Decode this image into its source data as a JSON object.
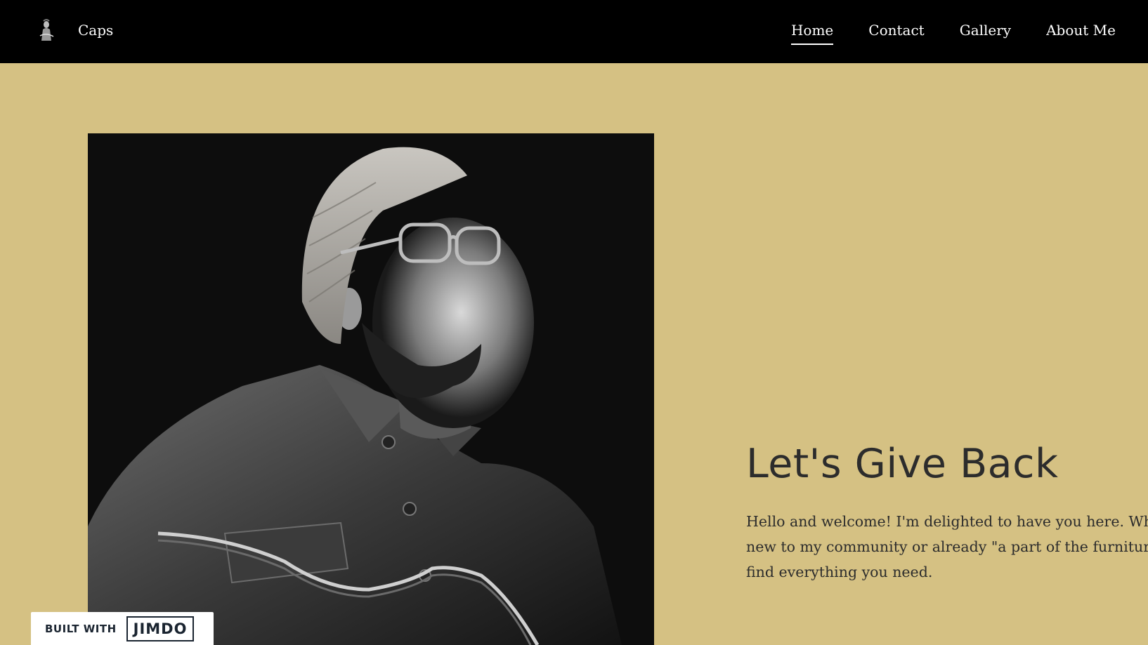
{
  "header": {
    "logo_icon": "musician-silhouette-icon",
    "site_title": "Caps",
    "nav": [
      {
        "label": "Home",
        "active": true
      },
      {
        "label": "Contact",
        "active": false
      },
      {
        "label": "Gallery",
        "active": false
      },
      {
        "label": "About Me",
        "active": false
      }
    ]
  },
  "hero": {
    "image_icon": "musician-portrait-photo",
    "headline": "Let's Give Back",
    "intro_lines": [
      "Hello and welcome! I'm delighted to have you here. Wheth",
      "new to my community or already \"a part of the furniture,\"",
      "find everything you need."
    ]
  },
  "badge": {
    "prefix": "BUILT WITH",
    "brand": "JIMDO"
  },
  "colors": {
    "header_bg": "#000000",
    "page_bg": "#d5c183",
    "text": "#2c2c2c",
    "badge_text": "#1a2430"
  }
}
